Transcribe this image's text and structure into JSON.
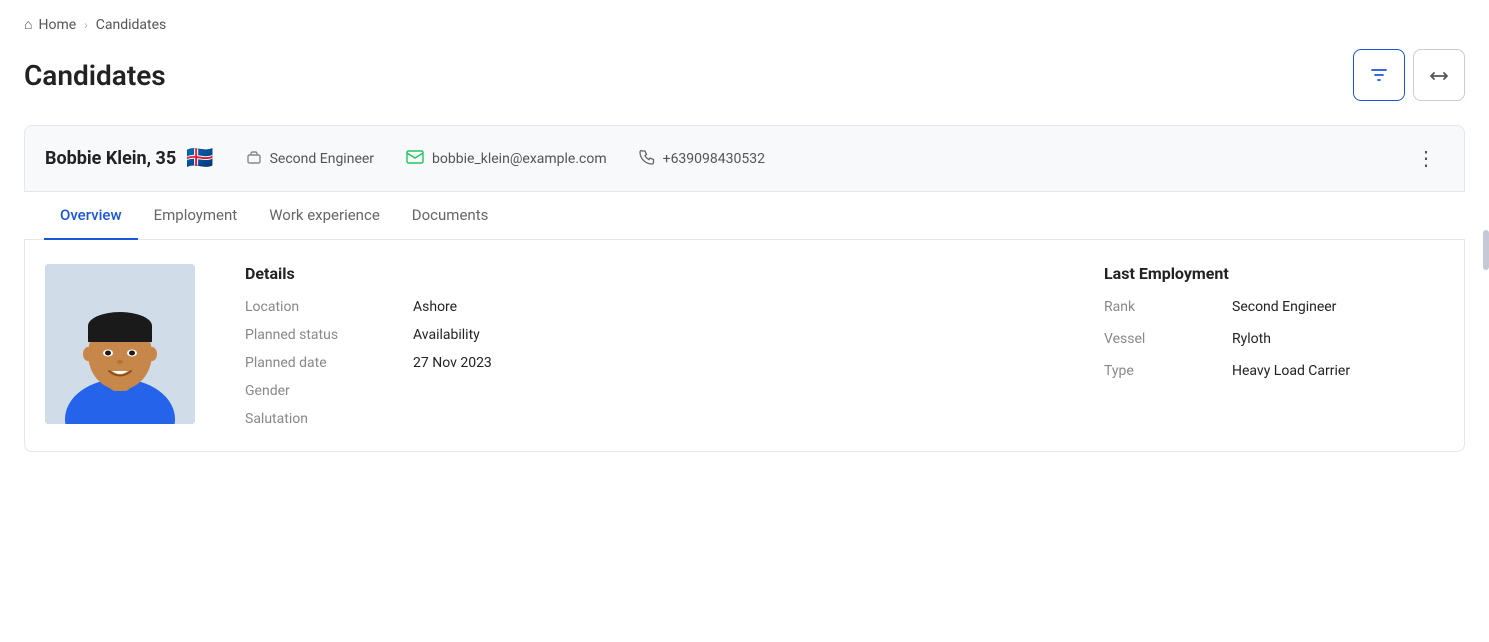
{
  "breadcrumb": {
    "home_label": "Home",
    "separator": "›",
    "current": "Candidates"
  },
  "page": {
    "title": "Candidates"
  },
  "toolbar": {
    "filter_label": "⊽",
    "transfer_label": "⇄"
  },
  "candidate": {
    "name": "Bobbie Klein, 35",
    "flag": "🇮🇸",
    "job_title": "Second Engineer",
    "email": "bobbie_klein@example.com",
    "phone": "+639098430532"
  },
  "tabs": [
    {
      "id": "overview",
      "label": "Overview",
      "active": true
    },
    {
      "id": "employment",
      "label": "Employment",
      "active": false
    },
    {
      "id": "work-experience",
      "label": "Work experience",
      "active": false
    },
    {
      "id": "documents",
      "label": "Documents",
      "active": false
    }
  ],
  "details": {
    "title": "Details",
    "fields": [
      {
        "label": "Location",
        "value": "Ashore"
      },
      {
        "label": "Planned status",
        "value": "Availability"
      },
      {
        "label": "Planned date",
        "value": "27 Nov 2023"
      },
      {
        "label": "Gender",
        "value": ""
      },
      {
        "label": "Salutation",
        "value": ""
      }
    ]
  },
  "last_employment": {
    "title": "Last Employment",
    "fields": [
      {
        "label": "Rank",
        "value": "Second Engineer"
      },
      {
        "label": "Vessel",
        "value": "Ryloth"
      },
      {
        "label": "Type",
        "value": "Heavy Load Carrier"
      }
    ]
  },
  "icons": {
    "home": "⌂",
    "briefcase": "💼",
    "email": "✉",
    "phone": "📞",
    "filter": "⊽",
    "transfer": "⇄",
    "more": "⋮"
  }
}
